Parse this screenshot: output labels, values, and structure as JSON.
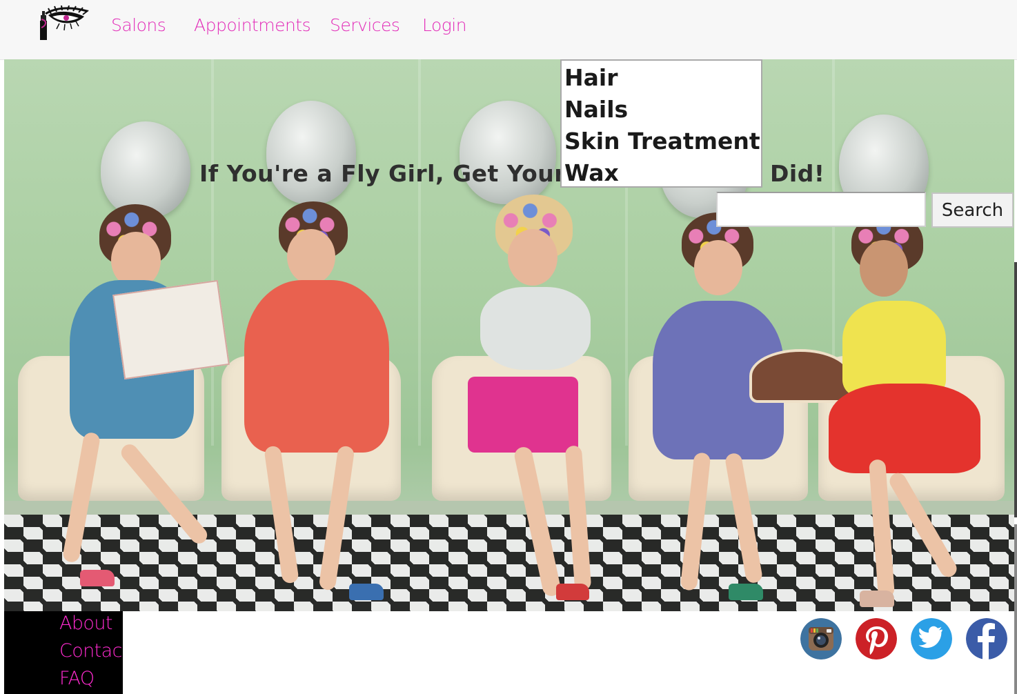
{
  "nav": {
    "logo_icon": "lash-and-mascara-logo-icon",
    "links": [
      "Salons",
      "Appointments",
      "Services",
      "Login"
    ]
  },
  "hero": {
    "tagline_before": "If You're a Fly Girl, Get Your",
    "tagline_after": "Did!",
    "background": "salon-dryers-photo",
    "service_options": [
      "Hair",
      "Nails",
      "Skin Treatment",
      "Wax"
    ],
    "search": {
      "value": "",
      "button_label": "Search"
    }
  },
  "footer": {
    "links": [
      "About",
      "Contact",
      "FAQ"
    ],
    "social_icons": [
      "instagram-icon",
      "pinterest-icon",
      "twitter-icon",
      "facebook-icon"
    ]
  },
  "colors": {
    "brand_pink": "#e22bb8",
    "footer_bg": "#000000",
    "nav_bg": "#f7f7f7"
  }
}
